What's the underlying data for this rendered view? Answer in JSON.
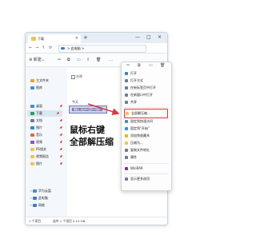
{
  "window": {
    "tab_title": "下载",
    "tab_close": "×",
    "new_tab": "+",
    "controls": [
      "—",
      "□",
      "×"
    ]
  },
  "nav": {
    "back": "←",
    "forward": "→",
    "up": "↑",
    "refresh": "⟳",
    "breadcrumb": "此电脑",
    "breadcrumb_sep": ">"
  },
  "toolbar": {
    "new_label": "新建",
    "new_caret": "⌄",
    "icons": [
      "✂",
      "⧉",
      "▭",
      "⇪",
      "🗑"
    ],
    "more": "…"
  },
  "sidebar": {
    "items": [
      {
        "label": "主文件夹",
        "icon": "home-icon",
        "color": "#e8a13a"
      },
      {
        "label": "图库",
        "icon": "gallery-icon",
        "color": "#3a8fd8"
      },
      {
        "label": "桌面",
        "icon": "desktop-icon",
        "color": "#3a8fd8",
        "pin": "📌"
      },
      {
        "label": "下载",
        "icon": "download-icon",
        "color": "#2a9d5e",
        "pin": "📌"
      },
      {
        "label": "文档",
        "icon": "document-icon",
        "color": "#6d7d8f",
        "pin": "📌"
      },
      {
        "label": "图片",
        "icon": "picture-icon",
        "color": "#2f86d6",
        "pin": "📌"
      },
      {
        "label": "音乐",
        "icon": "music-icon",
        "color": "#e06b3a",
        "pin": "📌"
      },
      {
        "label": "视频",
        "icon": "video-icon",
        "color": "#8a4fd3",
        "pin": "📌"
      },
      {
        "label": "PS相关",
        "icon": "folder-icon",
        "color": "#f4c24d",
        "pin": "📌"
      },
      {
        "label": "视频报告",
        "icon": "folder-icon",
        "color": "#f4c24d",
        "pin": "📌"
      },
      {
        "label": "图片",
        "icon": "folder-icon",
        "color": "#f4c24d",
        "pin": "📌"
      },
      {
        "label": "华为云盘",
        "icon": "cloud-icon",
        "color": "#3a8fd8"
      },
      {
        "label": "此电脑",
        "icon": "pc-icon",
        "color": "#3e7bc7"
      },
      {
        "label": "网络",
        "icon": "network-icon",
        "color": "#3e7bc7"
      }
    ]
  },
  "main": {
    "column_name": "名称",
    "group_header": "今天",
    "selected_file": "bag_xi_abc_Strinwr..."
  },
  "status": {
    "item_count": "1 个项目",
    "selection": "选中 1 个项目 2.13 GB"
  },
  "annotation": {
    "line1": "鼠标右键",
    "line2": "全部解压缩"
  },
  "context_menu": {
    "top_icons": [
      "✂",
      "⧉",
      "▭",
      "🗑"
    ],
    "items": [
      {
        "label": "打开",
        "color": "#2f86d6"
      },
      {
        "label": "打开方式",
        "color": "#6d7d8f"
      },
      {
        "label": "在新标签页中打开",
        "color": "#6d7d8f"
      },
      {
        "label": "在新窗口中打开",
        "color": "#6d7d8f"
      },
      {
        "label": "共享",
        "color": "#6d7d8f"
      },
      {
        "label": "全部解压缩...",
        "color": "#f4c24d",
        "highlight": true
      },
      {
        "label": "固定到快速访问",
        "color": "#3a8fd8"
      },
      {
        "label": "固定到\"开始\"",
        "color": "#3a8fd8"
      },
      {
        "label": "添加到收藏夹",
        "color": "#f0b400"
      },
      {
        "label": "压缩为...",
        "color": "#f4c24d"
      },
      {
        "label": "复制文件地址",
        "color": "#6d7d8f"
      },
      {
        "label": "属性",
        "color": "#6d7d8f"
      },
      {
        "label": "WinRAR",
        "color": "#8a2d8f"
      },
      {
        "label": "显示更多选项",
        "color": "#6d7d8f"
      }
    ]
  },
  "colors": {
    "accent": "#3e7bc7",
    "highlight_box": "#e5323c",
    "arrow": "#e5323c",
    "selection": "#cfd9ec"
  }
}
